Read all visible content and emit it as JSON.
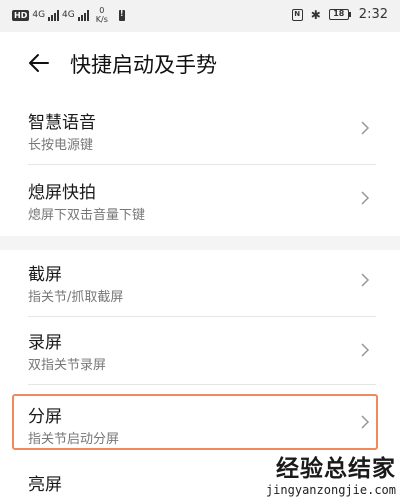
{
  "status_bar": {
    "hd_label": "HD",
    "net1": "4G",
    "net2": "4G",
    "speed_value": "0",
    "speed_unit": "K/s",
    "nfc_label": "N",
    "bluetooth_glyph": "✱",
    "battery_level": "18",
    "time": "2:32"
  },
  "header": {
    "title": "快捷启动及手势",
    "back_icon": "arrow-left-icon"
  },
  "items": [
    {
      "title": "智慧语音",
      "subtitle": "长按电源键"
    },
    {
      "title": "熄屏快拍",
      "subtitle": "熄屏下双击音量下键"
    },
    {
      "title": "截屏",
      "subtitle": "指关节/抓取截屏"
    },
    {
      "title": "录屏",
      "subtitle": "双指关节录屏"
    },
    {
      "title": "分屏",
      "subtitle": "指关节启动分屏"
    },
    {
      "title": "亮屏",
      "subtitle": ""
    }
  ],
  "highlight_color": "#f08a5d",
  "watermark": {
    "logo": "经验总结",
    "logo_suffix": "家",
    "url": "jingyanzongjie.com"
  }
}
